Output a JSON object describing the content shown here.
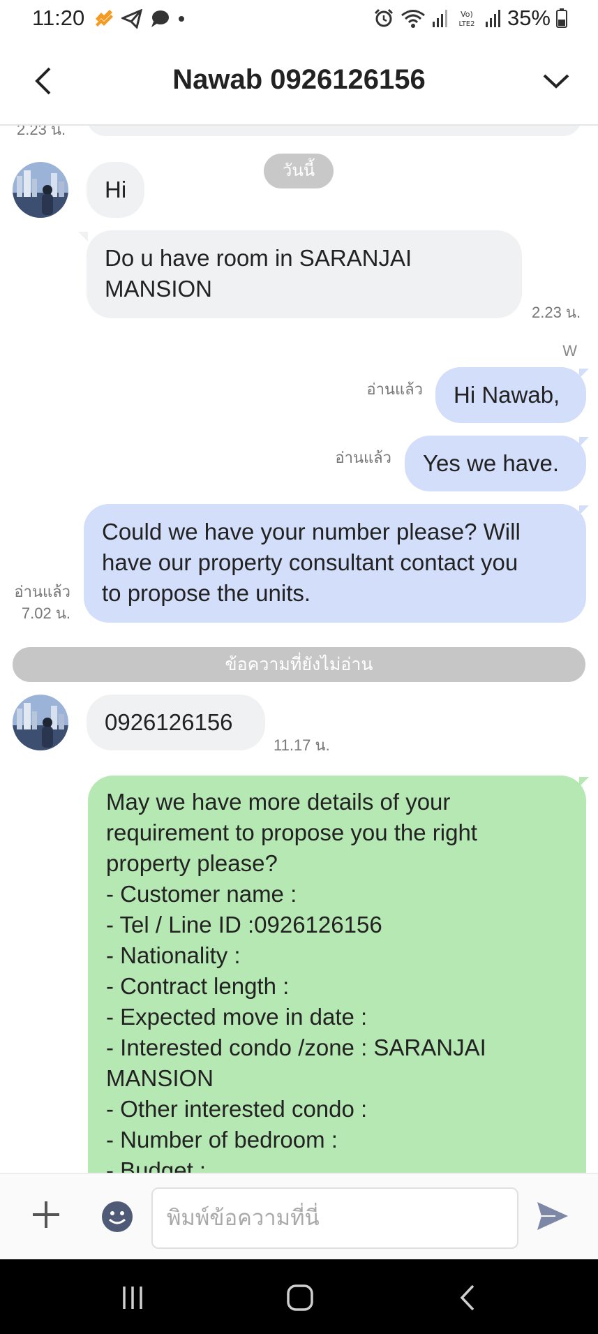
{
  "status_bar": {
    "time": "11:20",
    "battery": "35%",
    "signal_label": "Vo) LTE2"
  },
  "header": {
    "title": "Nawab 0926126156",
    "back_icon": "chevron-left-icon",
    "menu_icon": "chevron-down-icon"
  },
  "chat": {
    "top_clipped_time": "2.23 น.",
    "date_separator": "วันนี้",
    "messages": [
      {
        "text": "Hi"
      },
      {
        "text": "Do u have room in SARANJAI MANSION",
        "line1": "Do u have room in SARANJAI",
        "line2": "MANSION",
        "time": "2.23 น."
      },
      {
        "sender": "W"
      },
      {
        "text": "Hi Nawab,",
        "status": "อ่านแล้ว"
      },
      {
        "text": "Yes we have.",
        "status": "อ่านแล้ว"
      },
      {
        "line1": "Could we have your number please? Will",
        "line2": "have our property consultant contact you",
        "line3": "to propose the units.",
        "status": "อ่านแล้ว",
        "time": "7.02 น."
      }
    ],
    "unread_divider": "ข้อความที่ยังไม่อ่าน",
    "phone_message": {
      "text": "0926126156",
      "time": "11.17 น."
    },
    "details_message": {
      "lines": [
        "May we have more details of your",
        "requirement to propose you the right",
        "property please?",
        "- Customer name :",
        "- Tel / Line ID :0926126156",
        "- Nationality :",
        "- Contract length :",
        "- Expected move in date :",
        "- Interested condo /zone : SARANJAI",
        "MANSION",
        "- Other interested condo :",
        "- Number of bedroom  :",
        "- Budget :"
      ]
    }
  },
  "input_bar": {
    "placeholder": "พิมพ์ข้อความที่นี่"
  },
  "colors": {
    "incoming": "#f0f1f3",
    "outgoing": "#d3defa",
    "green": "#b6e8b3",
    "send": "#7d87a6"
  }
}
